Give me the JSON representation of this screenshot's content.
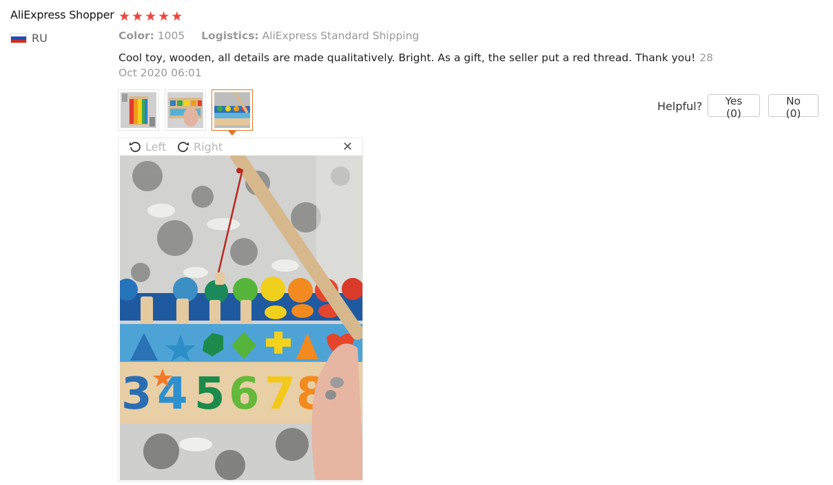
{
  "review": {
    "user_name": "AliExpress Shopper",
    "rating": 5,
    "stars": [
      "★",
      "★",
      "★",
      "★",
      "★"
    ],
    "country_code": "RU",
    "flag_colors": [
      "#ffffff",
      "#1f4fb8",
      "#d52b1e"
    ],
    "color_label": "Color:",
    "color_value": "1005",
    "logistics_label": "Logistics:",
    "logistics_value": "AliExpress Standard Shipping",
    "text": "Cool toy, wooden, all details are made qualitatively. Bright. As a gift, the seller put a red thread. Thank you!",
    "date": "28 Oct 2020 06:01",
    "thumbnails": [
      "photo-1",
      "photo-2",
      "photo-3"
    ],
    "active_thumbnail": 3
  },
  "helpful": {
    "label": "Helpful?",
    "yes_label": "Yes (0)",
    "no_label": "No (0)"
  },
  "viewer": {
    "rotate_left_label": "Left",
    "rotate_right_label": "Right",
    "close_glyph": "✕",
    "rotate_left_icon": "rotate-left-icon",
    "rotate_right_icon": "rotate-right-icon",
    "photo_numbers": [
      "3",
      "4",
      "5",
      "6",
      "7",
      "8"
    ]
  },
  "colors": {
    "star": "#f0453c",
    "active_border": "#e67322",
    "muted_text": "#999999"
  }
}
